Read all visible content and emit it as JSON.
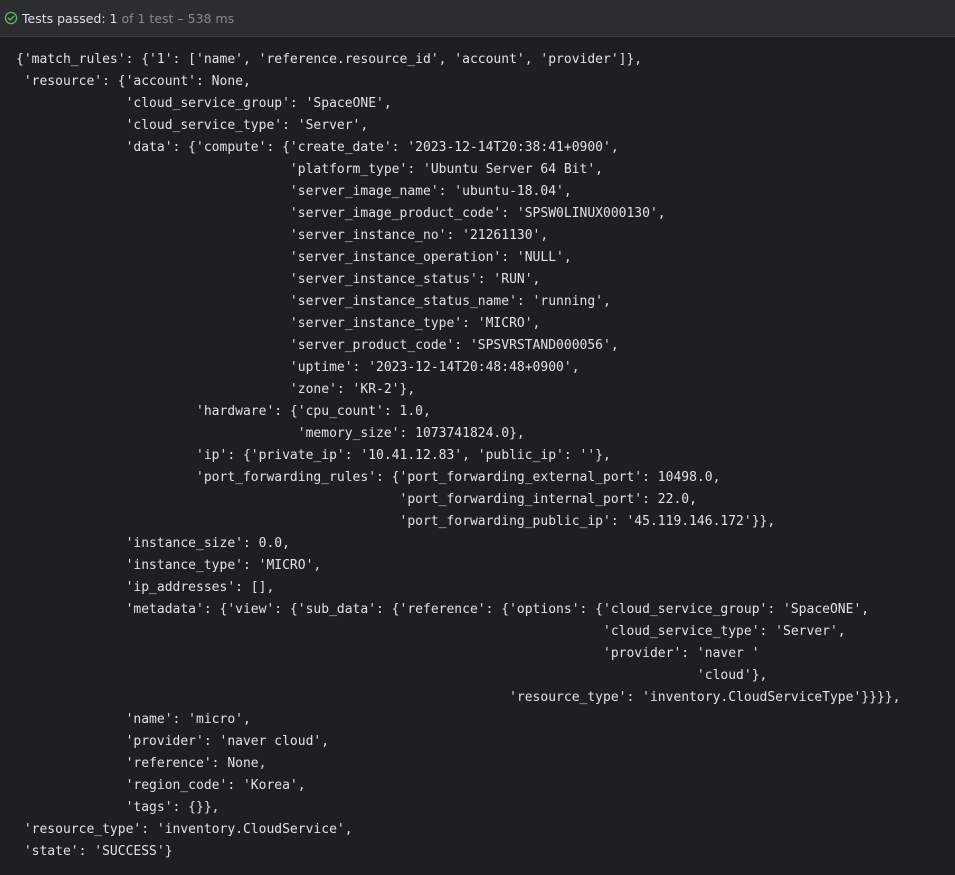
{
  "status": {
    "label": "Tests passed:",
    "passed": "1",
    "of_text": "of 1 test",
    "duration": "– 538 ms"
  },
  "icons": {
    "status": "check-circle-icon"
  },
  "colors": {
    "background": "#1e1f22",
    "status_bar": "#2b2d30",
    "success": "#5fb865",
    "text": "#dfe1e5"
  },
  "output_lines": [
    "{'match_rules': {'1': ['name', 'reference.resource_id', 'account', 'provider']},",
    " 'resource': {'account': None,",
    "              'cloud_service_group': 'SpaceONE',",
    "              'cloud_service_type': 'Server',",
    "              'data': {'compute': {'create_date': '2023-12-14T20:38:41+0900',",
    "                                   'platform_type': 'Ubuntu Server 64 Bit',",
    "                                   'server_image_name': 'ubuntu-18.04',",
    "                                   'server_image_product_code': 'SPSW0LINUX000130',",
    "                                   'server_instance_no': '21261130',",
    "                                   'server_instance_operation': 'NULL',",
    "                                   'server_instance_status': 'RUN',",
    "                                   'server_instance_status_name': 'running',",
    "                                   'server_instance_type': 'MICRO',",
    "                                   'server_product_code': 'SPSVRSTAND000056',",
    "                                   'uptime': '2023-12-14T20:48:48+0900',",
    "                                   'zone': 'KR-2'},",
    "                       'hardware': {'cpu_count': 1.0,",
    "                                    'memory_size': 1073741824.0},",
    "                       'ip': {'private_ip': '10.41.12.83', 'public_ip': ''},",
    "                       'port_forwarding_rules': {'port_forwarding_external_port': 10498.0,",
    "                                                 'port_forwarding_internal_port': 22.0,",
    "                                                 'port_forwarding_public_ip': '45.119.146.172'}},",
    "              'instance_size': 0.0,",
    "              'instance_type': 'MICRO',",
    "              'ip_addresses': [],",
    "              'metadata': {'view': {'sub_data': {'reference': {'options': {'cloud_service_group': 'SpaceONE',",
    "                                                                           'cloud_service_type': 'Server',",
    "                                                                           'provider': 'naver '",
    "                                                                                       'cloud'},",
    "                                                               'resource_type': 'inventory.CloudServiceType'}}}},",
    "              'name': 'micro',",
    "              'provider': 'naver cloud',",
    "              'reference': None,",
    "              'region_code': 'Korea',",
    "              'tags': {}},",
    " 'resource_type': 'inventory.CloudService',",
    " 'state': 'SUCCESS'}"
  ]
}
